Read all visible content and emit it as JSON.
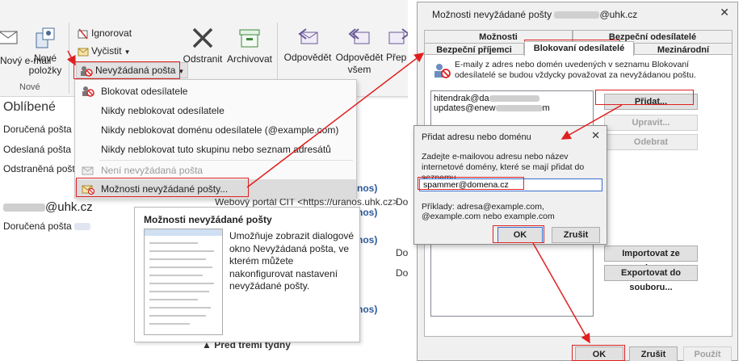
{
  "ribbon": {
    "new_email_label": "Nový e-mail",
    "new_items_label": "Nové položky",
    "new_group_label": "Nové",
    "ignore_label": "Ignorovat",
    "cleanup_label": "Vyčistit",
    "junk_label": "Nevyžádaná pošta",
    "delete_label": "Odstranit",
    "archive_label": "Archivovat",
    "reply_label": "Odpovědět",
    "reply_all_label": "Odpovědět všem",
    "forward_label": "Přep"
  },
  "nav": {
    "favorites_label": "Oblíbené",
    "items": [
      "Doručená pošta",
      "Odeslaná pošta",
      "Odstraněná pošta"
    ],
    "account_suffix": "@uhk.cz",
    "account_inbox": "Doručená pošta"
  },
  "mail_list": {
    "row1_sender": "nos)",
    "row1_preview": "Webový portál CIT <https://uranos.uhk.cz>",
    "row1_col": "Do",
    "row2_sender": "nos)",
    "row2_col": "Do",
    "row3_sender": "nos)",
    "row4_sender": "nos)",
    "footer_group": "Před třemi týdny"
  },
  "junk_menu": {
    "items": [
      {
        "label": "Blokovat odesílatele",
        "disabled": false
      },
      {
        "label": "Nikdy neblokovat odesílatele",
        "disabled": false
      },
      {
        "label": "Nikdy neblokovat doménu odesílatele (@example.com)",
        "disabled": false
      },
      {
        "label": "Nikdy neblokovat tuto skupinu nebo seznam adresátů",
        "disabled": false
      },
      {
        "label": "Není nevyžádaná pošta",
        "disabled": true
      },
      {
        "label": "Možnosti nevyžádané pošty...",
        "disabled": false
      }
    ]
  },
  "tooltip": {
    "title": "Možnosti nevyžádané pošty",
    "description": "Umožňuje zobrazit dialogové okno Nevyžádaná pošta, ve kterém můžete nakonfigurovat nastavení nevyžádané pošty."
  },
  "dialog": {
    "title_prefix": "Možnosti nevyžádané pošty",
    "title_suffix": "@uhk.cz",
    "close_glyph": "✕",
    "tabs_row1": [
      "Možnosti",
      "Bezpeční odesílatelé"
    ],
    "tabs_row2": [
      "Bezpeční příjemci",
      "Blokovaní odesílatelé",
      "Mezinárodní"
    ],
    "active_tab": "Blokovaní odesílatelé",
    "info_text": "E-maily z adres nebo domén uvedených v seznamu Blokovaní odesílatelé se budou vždycky považovat za nevyžádanou poštu.",
    "list_items": [
      {
        "prefix": "hitendrak@da",
        "suffix": ""
      },
      {
        "prefix": "updates@enew",
        "suffix": "m"
      }
    ],
    "add_button": "Přidat...",
    "edit_button": "Upravit...",
    "remove_button": "Odebrat",
    "import_button": "Importovat ze souboru...",
    "export_button": "Exportovat do souboru...",
    "ok_button": "OK",
    "cancel_button": "Zrušit",
    "apply_button": "Použít"
  },
  "add_dialog": {
    "title": "Přidat adresu nebo doménu",
    "close_glyph": "✕",
    "description": "Zadejte e-mailovou adresu nebo název internetové domény, které se mají přidat do seznamu.",
    "input_value": "spammer@domena.cz",
    "examples": "Příklady: adresa@example.com, @example.com nebo example.com",
    "ok_button": "OK",
    "cancel_button": "Zrušit"
  },
  "colors": {
    "highlight_red": "#e02020",
    "link_blue": "#2a5a9b",
    "ribbon_bg": "#f3f3f3",
    "dialog_bg": "#f0f0f0"
  }
}
